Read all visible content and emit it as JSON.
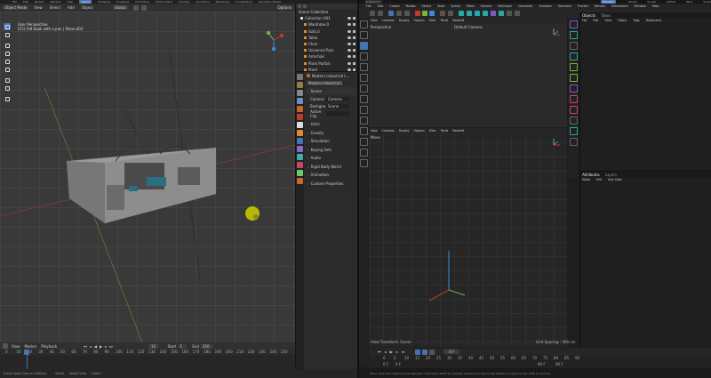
{
  "colors": {
    "accent": "#4772b3",
    "c4d_teal": "#2aa",
    "x_axis": "#c0392b",
    "y_axis": "#7ab33a",
    "z_axis": "#3a8cd6"
  },
  "blender": {
    "top_menu": [
      "File",
      "Edit",
      "Render",
      "Window",
      "Help",
      "Layout",
      "Modeling",
      "Sculpting",
      "UV Editing",
      "Texture Paint",
      "Shading",
      "Animation",
      "Rendering",
      "Compositing",
      "Geometry Nodes"
    ],
    "viewport_header": {
      "mode": "Object Mode",
      "items": [
        "View",
        "Select",
        "Add",
        "Object"
      ],
      "transform": "Global",
      "options": "Options"
    },
    "viewport_overlay": {
      "line1": "User Perspective",
      "line2": "(15) Old book with a pen | Plane.003"
    },
    "timeline": {
      "menus": [
        "View",
        "Marker",
        "Playback"
      ],
      "current_frame": "15",
      "start_label": "Start",
      "start": "1",
      "end_label": "End",
      "end": "250",
      "ticks": [
        "0",
        "10",
        "20",
        "30",
        "40",
        "50",
        "60",
        "70",
        "80",
        "90",
        "100",
        "110",
        "120",
        "130",
        "140",
        "150",
        "160",
        "170",
        "180",
        "190",
        "200",
        "210",
        "220",
        "230",
        "240",
        "250"
      ]
    },
    "status_bar": "Active object has no modifiers",
    "status_hints": [
      "Select",
      "Rotate View",
      "Object"
    ],
    "outliner": {
      "title": "Scene Collection",
      "rows": [
        "Collection 001",
        "Wardrobe.0",
        "Sofa.0",
        "Table",
        "Chair",
        "Universal Ruin",
        "Armchair",
        "Plant Parfait",
        "Plant",
        "Plane Parfait",
        "Curve"
      ]
    },
    "properties": {
      "scene": "Modern Industrial L...",
      "sub": "Scene",
      "camera_label": "Camera",
      "camera": "Camera",
      "bg_label": "Backgrou...",
      "bg": "Scene",
      "clip_label": "Active Clip",
      "sections": [
        "Units",
        "Gravity",
        "Simulation",
        "Keying Sets",
        "Audio",
        "Rigid Body World",
        "Animation",
        "Custom Properties"
      ]
    }
  },
  "c4d": {
    "title": "Untitled 1*",
    "layout": "Standard",
    "layouts": [
      "Model",
      "Sculpt",
      "UVEdit",
      "Paint",
      "Script"
    ],
    "menu": [
      "File",
      "Edit",
      "Create",
      "Modes",
      "Select",
      "Tools",
      "Spline",
      "Mesh",
      "Volume",
      "MoGraph",
      "Character",
      "Animate",
      "Simulate",
      "Tracker",
      "Render",
      "Extensions",
      "Window",
      "Help"
    ],
    "vp1": {
      "menus": [
        "View",
        "Cameras",
        "Display",
        "Options",
        "Filter",
        "Panel",
        "Redshift"
      ],
      "name": "Perspective",
      "camera": "Default Camera"
    },
    "vp2": {
      "menus": [
        "View",
        "Cameras",
        "Display",
        "Options",
        "Filter",
        "Panel",
        "Redshift"
      ],
      "name": "Move",
      "footer": "View Transform: Scene",
      "grid": "Grid Spacing : 500 cm"
    },
    "objects": {
      "tabs": [
        "Objects",
        "Takes"
      ],
      "menu": [
        "File",
        "Edit",
        "View",
        "Object",
        "Tags",
        "Bookmarks"
      ]
    },
    "attributes": {
      "tabs": [
        "Attributes",
        "Layers"
      ],
      "menu": [
        "Mode",
        "Edit",
        "User Data"
      ]
    },
    "timeline": {
      "frame": "0 F",
      "start": "0 F",
      "end": "90 F",
      "ticks": [
        "0",
        "5",
        "10",
        "15",
        "20",
        "25",
        "30",
        "35",
        "40",
        "45",
        "50",
        "55",
        "60",
        "65",
        "70",
        "75",
        "80",
        "85",
        "90"
      ]
    },
    "status": "Move: Click and drag to move elements. Hold down SHIFT to quantize movement / add to the selection in point mode, CTRL to remove."
  }
}
